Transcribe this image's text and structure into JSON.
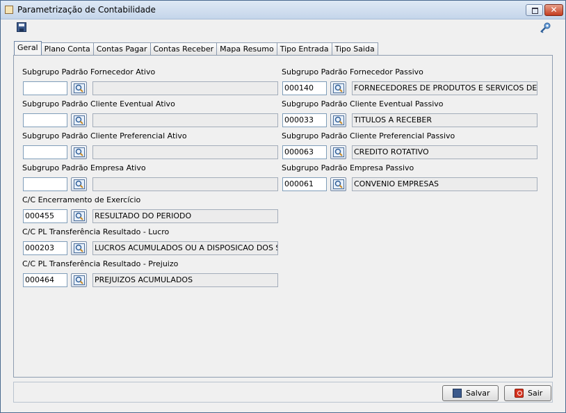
{
  "window": {
    "title": "Parametrização de Contabilidade",
    "close_symbol": "✕"
  },
  "toolbar": {
    "save_icon": "save-icon",
    "search_icon": "key-search-icon"
  },
  "tabs": [
    {
      "label": "Geral",
      "active": true
    },
    {
      "label": "Plano Conta",
      "active": false
    },
    {
      "label": "Contas Pagar",
      "active": false
    },
    {
      "label": "Contas Receber",
      "active": false
    },
    {
      "label": "Mapa Resumo",
      "active": false
    },
    {
      "label": "Tipo Entrada",
      "active": false
    },
    {
      "label": "Tipo Saida",
      "active": false
    }
  ],
  "fields": {
    "forn_ativo": {
      "label": "Subgrupo Padrão Fornecedor Ativo",
      "code": "",
      "desc": ""
    },
    "forn_passivo": {
      "label": "Subgrupo Padrão Fornecedor Passivo",
      "code": "000140",
      "desc": "FORNECEDORES DE PRODUTOS E SERVICOS DE ATIVI"
    },
    "cli_ev_ativo": {
      "label": "Subgrupo Padrão Cliente Eventual Ativo",
      "code": "",
      "desc": ""
    },
    "cli_ev_passivo": {
      "label": "Subgrupo Padrão Cliente Eventual Passivo",
      "code": "000033",
      "desc": "TITULOS A RECEBER"
    },
    "cli_pref_ativo": {
      "label": "Subgrupo Padrão Cliente Preferencial Ativo",
      "code": "",
      "desc": ""
    },
    "cli_pref_passivo": {
      "label": "Subgrupo Padrão Cliente Preferencial Passivo",
      "code": "000063",
      "desc": "CREDITO ROTATIVO"
    },
    "emp_ativo": {
      "label": "Subgrupo Padrão Empresa Ativo",
      "code": "",
      "desc": ""
    },
    "emp_passivo": {
      "label": "Subgrupo Padrão Empresa Passivo",
      "code": "000061",
      "desc": "CONVENIO EMPRESAS"
    },
    "cc_encerramento": {
      "label": "C/C Encerramento de Exercício",
      "code": "000455",
      "desc": "RESULTADO DO PERIODO"
    },
    "cc_lucro": {
      "label": "C/C PL Transferência Resultado - Lucro",
      "code": "000203",
      "desc": "LUCROS ACUMULADOS OU A DISPOSICAO DOS SOCIO"
    },
    "cc_prejuizo": {
      "label": "C/C PL Transferência Resultado - Prejuizo",
      "code": "000464",
      "desc": "PREJUIZOS ACUMULADOS"
    }
  },
  "buttons": {
    "save_label": "Salvar",
    "exit_label": "Sair"
  }
}
